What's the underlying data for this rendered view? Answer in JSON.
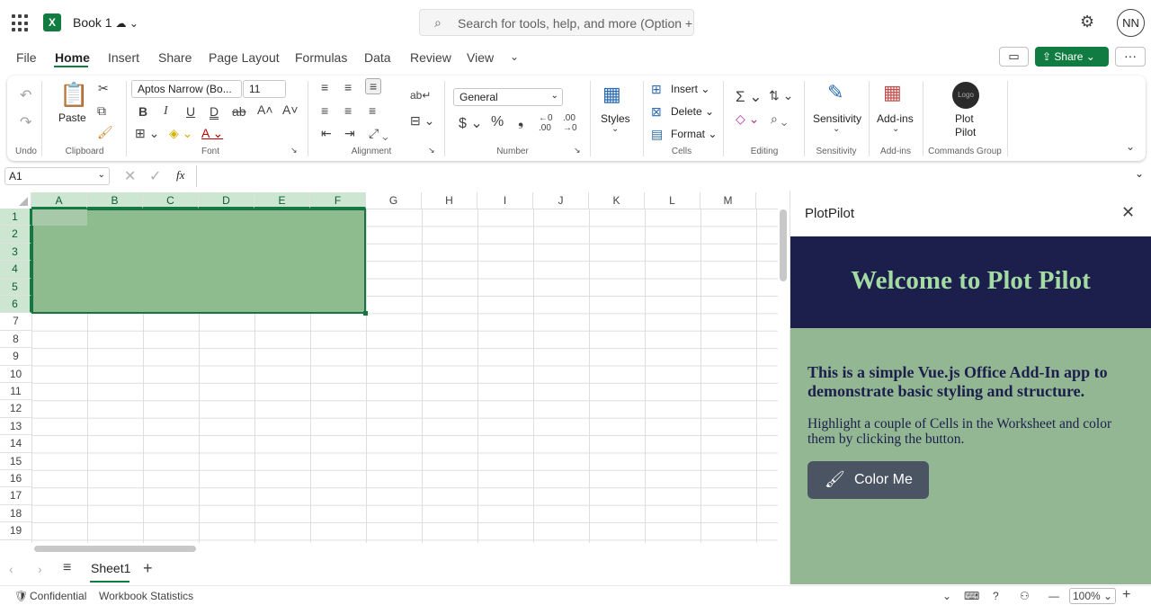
{
  "titlebar": {
    "app_icon": "X",
    "book_title": "Book 1",
    "search_placeholder": "Search for tools, help, and more (Option + Q)",
    "avatar": "NN"
  },
  "menu": {
    "file": "File",
    "home": "Home",
    "insert": "Insert",
    "share": "Share",
    "page_layout": "Page Layout",
    "formulas": "Formulas",
    "data": "Data",
    "review": "Review",
    "view": "View",
    "share_button": "Share"
  },
  "ribbon": {
    "undo_group": "Undo",
    "paste": "Paste",
    "clipboard_group": "Clipboard",
    "font_name": "Aptos Narrow (Bo...",
    "font_size": "11",
    "font_group": "Font",
    "alignment_group": "Alignment",
    "number_format": "General",
    "number_group": "Number",
    "styles": "Styles",
    "insert": "Insert",
    "delete": "Delete",
    "format": "Format",
    "cells_group": "Cells",
    "editing_group": "Editing",
    "sensitivity": "Sensitivity",
    "sensitivity_group": "Sensitivity",
    "addins": "Add-ins",
    "addins_group": "Add-ins",
    "plotpilot_logo": "Logo",
    "plotpilot_line1": "Plot",
    "plotpilot_line2": "Pilot",
    "commands_group": "Commands Group"
  },
  "formula_bar": {
    "name_box": "A1",
    "fx": "fx"
  },
  "grid": {
    "columns": [
      "A",
      "B",
      "C",
      "D",
      "E",
      "F",
      "G",
      "H",
      "I",
      "J",
      "K",
      "L",
      "M"
    ],
    "rows": [
      "1",
      "2",
      "3",
      "4",
      "5",
      "6",
      "7",
      "8",
      "9",
      "10",
      "11",
      "12",
      "13",
      "14",
      "15",
      "16",
      "17",
      "18",
      "19"
    ],
    "selection_color": "#8fbc8f"
  },
  "sheets": {
    "active": "Sheet1"
  },
  "status": {
    "confidential": "Confidential",
    "stats": "Workbook Statistics",
    "zoom": "100%"
  },
  "task_pane": {
    "title": "PlotPilot",
    "heading": "Welcome to Plot Pilot",
    "lead": "This is a simple Vue.js Office Add-In app to demonstrate basic styling and structure.",
    "description": "Highlight a couple of Cells in the Worksheet and color them by clicking the button.",
    "button_label": "Color Me",
    "header_bg": "#1c1e4c",
    "body_bg": "#93b793",
    "heading_color": "#a3dba3"
  }
}
